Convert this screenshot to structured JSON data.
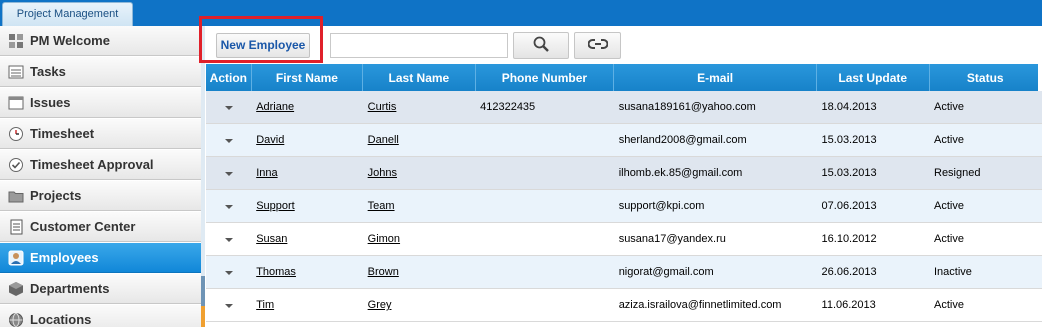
{
  "app": {
    "tab_label": "Project Management"
  },
  "sidebar": {
    "items": [
      {
        "label": "PM Welcome",
        "icon": "grid-icon"
      },
      {
        "label": "Tasks",
        "icon": "list-icon"
      },
      {
        "label": "Issues",
        "icon": "window-icon"
      },
      {
        "label": "Timesheet",
        "icon": "clock-icon"
      },
      {
        "label": "Timesheet Approval",
        "icon": "check-circle-icon"
      },
      {
        "label": "Projects",
        "icon": "folder-icon"
      },
      {
        "label": "Customer Center",
        "icon": "document-icon"
      },
      {
        "label": "Employees",
        "icon": "user-icon",
        "active": true
      },
      {
        "label": "Departments",
        "icon": "cube-icon"
      },
      {
        "label": "Locations",
        "icon": "globe-icon"
      }
    ]
  },
  "toolbar": {
    "new_employee_label": "New Employee",
    "search_placeholder": "",
    "search_value": ""
  },
  "grid": {
    "columns": [
      "Action",
      "First Name",
      "Last Name",
      "Phone Number",
      "E-mail",
      "Last Update",
      "Status"
    ],
    "rows": [
      {
        "first": "Adriane",
        "last": "Curtis",
        "phone": "412322435",
        "email": "susana189161@yahoo.com",
        "updated": "18.04.2013",
        "status": "Active"
      },
      {
        "first": "David",
        "last": "Danell",
        "phone": "",
        "email": "sherland2008@gmail.com",
        "updated": "15.03.2013",
        "status": "Active"
      },
      {
        "first": "Inna",
        "last": "Johns",
        "phone": "",
        "email": "ilhomb.ek.85@gmail.com",
        "updated": "15.03.2013",
        "status": "Resigned"
      },
      {
        "first": "Support",
        "last": "Team",
        "phone": "",
        "email": "support@kpi.com",
        "updated": "07.06.2013",
        "status": "Active"
      },
      {
        "first": "Susan",
        "last": "Gimon",
        "phone": "",
        "email": "susana17@yandex.ru",
        "updated": "16.10.2012",
        "status": "Active"
      },
      {
        "first": "Thomas",
        "last": "Brown",
        "phone": "",
        "email": "nigorat@gmail.com",
        "updated": "26.06.2013",
        "status": "Inactive"
      },
      {
        "first": "Tim",
        "last": "Grey",
        "phone": "",
        "email": "aziza.israilova@finnetlimited.com",
        "updated": "11.06.2013",
        "status": "Active"
      }
    ]
  },
  "colors": {
    "accent": "#1782c9",
    "active_nav": "#1187d8",
    "highlight": "#e0202a",
    "link": "#1a57a8"
  }
}
